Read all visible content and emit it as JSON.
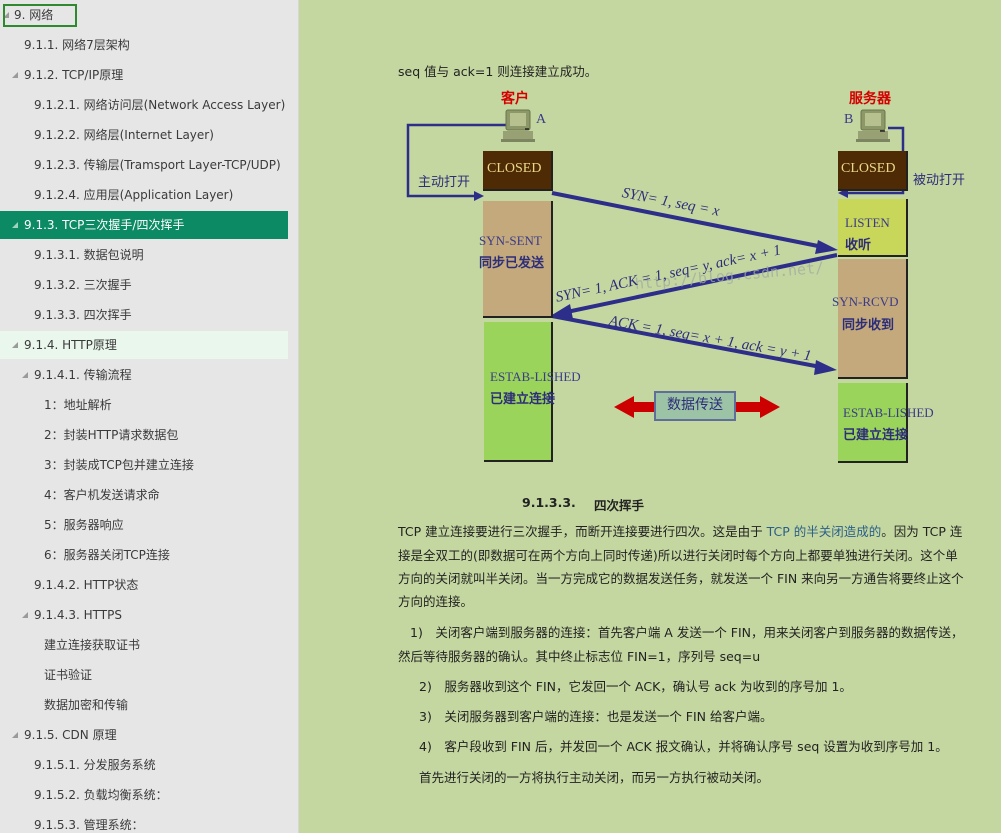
{
  "sidebar": {
    "items": [
      {
        "label": "9. 网络",
        "level": 0,
        "expanded": true,
        "focused": true
      },
      {
        "label": "9.1.1. 网络7层架构",
        "level": 1
      },
      {
        "label": "9.1.2. TCP/IP原理",
        "level": 1,
        "expanded": true
      },
      {
        "label": "9.1.2.1. 网络访问层(Network Access Layer)",
        "level": 2
      },
      {
        "label": "9.1.2.2. 网络层(Internet Layer)",
        "level": 2
      },
      {
        "label": "9.1.2.3. 传输层(Tramsport Layer-TCP/UDP)",
        "level": 2
      },
      {
        "label": "9.1.2.4. 应用层(Application Layer)",
        "level": 2
      },
      {
        "label": "9.1.3. TCP三次握手/四次挥手",
        "level": 1,
        "expanded": true,
        "active": true
      },
      {
        "label": "9.1.3.1. 数据包说明",
        "level": 2
      },
      {
        "label": "9.1.3.2. 三次握手",
        "level": 2
      },
      {
        "label": "9.1.3.3. 四次挥手",
        "level": 2
      },
      {
        "label": "9.1.4. HTTP原理",
        "level": 1,
        "expanded": true,
        "hover": true
      },
      {
        "label": "9.1.4.1. 传输流程",
        "level": 2,
        "expanded": true
      },
      {
        "label": "1：地址解析",
        "level": 3
      },
      {
        "label": "2：封装HTTP请求数据包",
        "level": 3
      },
      {
        "label": "3：封装成TCP包并建立连接",
        "level": 3
      },
      {
        "label": "4：客户机发送请求命",
        "level": 3
      },
      {
        "label": "5：服务器响应",
        "level": 3
      },
      {
        "label": "6：服务器关闭TCP连接",
        "level": 3
      },
      {
        "label": "9.1.4.2. HTTP状态",
        "level": 2
      },
      {
        "label": "9.1.4.3. HTTPS",
        "level": 2,
        "expanded": true
      },
      {
        "label": "建立连接获取证书",
        "level": 3
      },
      {
        "label": "证书验证",
        "level": 3
      },
      {
        "label": "数据加密和传输",
        "level": 3
      },
      {
        "label": "9.1.5. CDN 原理",
        "level": 1,
        "expanded": true
      },
      {
        "label": "9.1.5.1. 分发服务系统",
        "level": 2
      },
      {
        "label": "9.1.5.2. 负载均衡系统：",
        "level": 2
      },
      {
        "label": "9.1.5.3. 管理系统：",
        "level": 2
      }
    ]
  },
  "main": {
    "intro_line": "seq 值与 ack=1 则连接建立成功。",
    "diagram": {
      "client_title": "客户",
      "server_title": "服务器",
      "client_letter": "A",
      "server_letter": "B",
      "active_open": "主动打开",
      "passive_open": "被动打开",
      "client_states": [
        {
          "en": "CLOSED",
          "zh": ""
        },
        {
          "en": "SYN-SENT",
          "zh": "同步已发送"
        },
        {
          "en": "ESTAB-LISHED",
          "zh": "已建立连接"
        }
      ],
      "server_states": [
        {
          "en": "CLOSED",
          "zh": ""
        },
        {
          "en": "LISTEN",
          "zh": "收听"
        },
        {
          "en": "SYN-RCVD",
          "zh": "同步收到"
        },
        {
          "en": "ESTAB-LISHED",
          "zh": "已建立连接"
        }
      ],
      "messages": [
        "SYN= 1, seq = x",
        "SYN= 1, ACK = 1, seq= y, ack= x + 1",
        "ACK = 1, seq= x + 1, ack = y + 1"
      ],
      "data_transfer": "数据传送",
      "watermark": "http://blog.csdn.net/"
    },
    "section_number": "9.1.3.3.",
    "section_title": "四次挥手",
    "para1": {
      "line1_pre": "TCP 建立连接要进行三次握手，而断开连接要进行四次。这是由于 ",
      "line1_link": "TCP 的半关闭造成的",
      "line1_post": "。因为 TCP 连",
      "line2": "接是全双工的(即数据可在两个方向上同时传递)所以进行关闭时每个方向上都要单独进行关闭。这个单",
      "line3": "方向的关闭就叫半关闭。当一方完成它的数据发送任务，就发送一个 FIN 来向另一方通告将要终止这个",
      "line4": "方向的连接。"
    },
    "steps": [
      "1)　关闭客户端到服务器的连接：首先客户端 A 发送一个 FIN，用来关闭客户到服务器的数据传送，",
      "然后等待服务器的确认。其中终止标志位 FIN=1，序列号 seq=u",
      "2)　服务器收到这个 FIN，它发回一个 ACK，确认号 ack 为收到的序号加 1。",
      "3)　关闭服务器到客户端的连接：也是发送一个 FIN 给客户端。",
      "4)　客户段收到 FIN 后，并发回一个 ACK 报文确认，并将确认序号 seq 设置为收到序号加 1。",
      "首先进行关闭的一方将执行主动关闭，而另一方执行被动关闭。"
    ]
  }
}
